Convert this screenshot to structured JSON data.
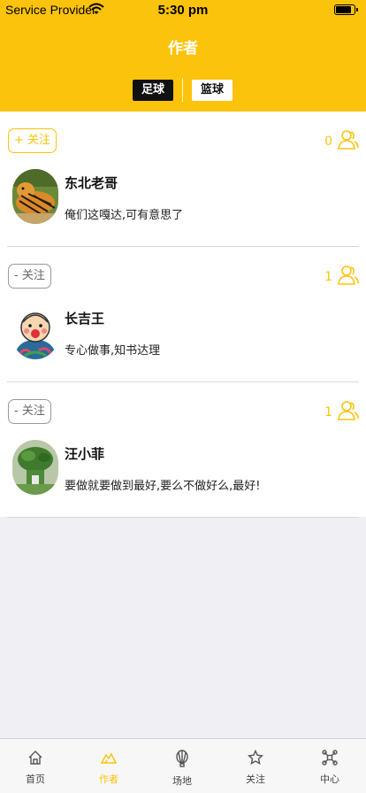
{
  "status_bar": {
    "carrier": "Service Provider",
    "time": "5:30 pm"
  },
  "nav": {
    "title": "作者"
  },
  "segments": [
    {
      "label": "足球",
      "active": true
    },
    {
      "label": "篮球",
      "active": false
    }
  ],
  "authors": [
    {
      "follow_label": "+ 关注",
      "followers": "0",
      "name": "东北老哥",
      "bio": "俺们这嘎达,可有意思了"
    },
    {
      "follow_label": "- 关注",
      "followers": "1",
      "name": "长吉王",
      "bio": "专心做事,知书达理"
    },
    {
      "follow_label": "- 关注",
      "followers": "1",
      "name": "汪小菲",
      "bio": "要做就要做到最好,要么不做好么,最好!"
    }
  ],
  "tabs": [
    {
      "label": "首页",
      "icon": "home-icon"
    },
    {
      "label": "作者",
      "icon": "mountain-icon",
      "active": true
    },
    {
      "label": "场地",
      "icon": "balloon-icon"
    },
    {
      "label": "关注",
      "icon": "star-icon"
    },
    {
      "label": "中心",
      "icon": "drone-icon"
    }
  ],
  "colors": {
    "accent": "#fcc30c",
    "background": "#efeff4"
  }
}
